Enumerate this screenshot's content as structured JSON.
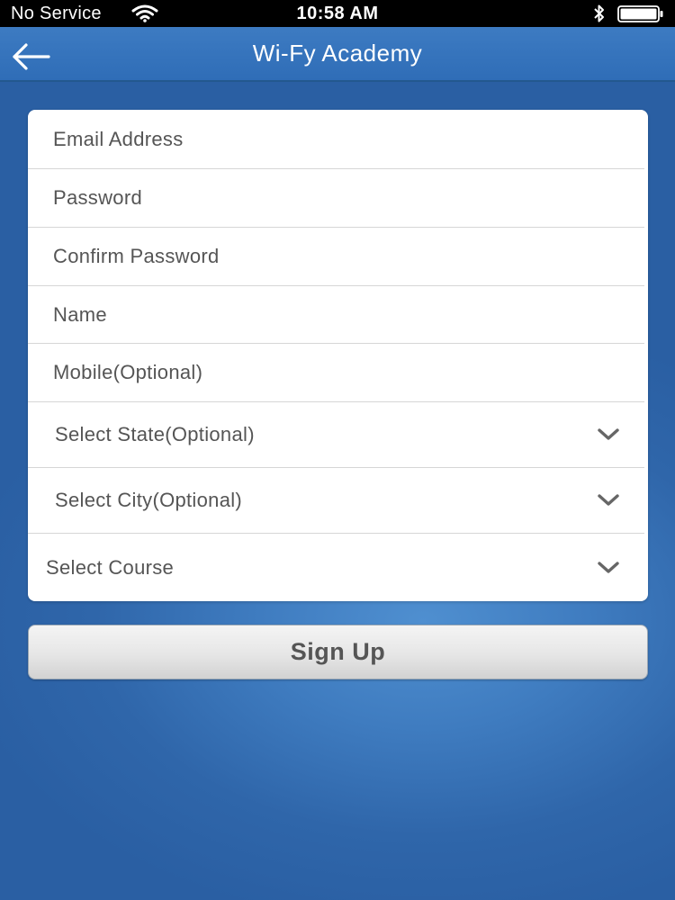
{
  "status_bar": {
    "carrier": "No Service",
    "time": "10:58 AM",
    "icons": [
      "wifi-icon",
      "bluetooth-icon",
      "battery-icon"
    ]
  },
  "nav": {
    "title": "Wi-Fy Academy",
    "back_icon": "arrow-left-icon"
  },
  "form": {
    "email_placeholder": "Email Address",
    "password_placeholder": "Password",
    "confirm_password_placeholder": "Confirm Password",
    "name_placeholder": "Name",
    "mobile_placeholder": "Mobile(Optional)",
    "state_label": "Select State(Optional)",
    "city_label": "Select City(Optional)",
    "course_label": "Select Course",
    "dropdown_icon": "chevron-down-icon"
  },
  "actions": {
    "signup_label": "Sign Up"
  },
  "colors": {
    "status_bar_bg": "#000000",
    "nav_bar_bg": "#3574bd",
    "page_bg": "#2f66aa",
    "card_bg": "#ffffff",
    "placeholder_text": "#555555",
    "divider": "#d6d6d6",
    "button_bg": "#e6e6e6"
  }
}
